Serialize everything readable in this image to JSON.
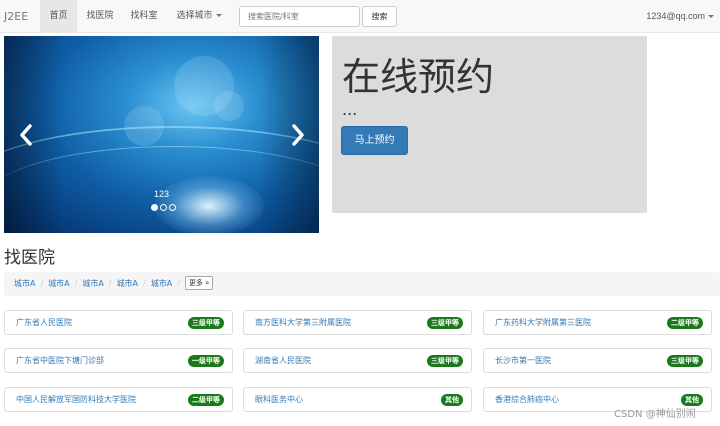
{
  "navbar": {
    "brand": "J2EE",
    "items": [
      {
        "label": "首页",
        "active": true
      },
      {
        "label": "找医院",
        "active": false
      },
      {
        "label": "找科室",
        "active": false
      },
      {
        "label": "选择城市",
        "active": false
      }
    ],
    "search": {
      "placeholder": "搜索医院/科室",
      "button": "搜索"
    },
    "user": "1234@qq.com"
  },
  "carousel": {
    "caption": "123",
    "prev_icon": "chevron-left-icon",
    "next_icon": "chevron-right-icon",
    "slide_count": 3,
    "active_slide": 1
  },
  "jumbotron": {
    "title": "在线预约",
    "text": "...",
    "button": "马上预约"
  },
  "hospitals_section": {
    "title": "找医院",
    "breadcrumb": [
      "城市A",
      "城市A",
      "城市A",
      "城市A",
      "城市A"
    ],
    "more": "更多 »",
    "hospitals": [
      {
        "name": "广东省人民医院",
        "level": "三级甲等"
      },
      {
        "name": "南方医科大学第三附属医院",
        "level": "三级甲等"
      },
      {
        "name": "广东药科大学附属第三医院",
        "level": "二级甲等"
      },
      {
        "name": "广东省中医院下塘门诊部",
        "level": "一级甲等"
      },
      {
        "name": "湖南省人民医院",
        "level": "三级甲等"
      },
      {
        "name": "长沙市第一医院",
        "level": "三级甲等"
      },
      {
        "name": "中国人民解放军国防科技大学医院",
        "level": "二级甲等"
      },
      {
        "name": "眼科医务中心",
        "level": "其他"
      },
      {
        "name": "香港综合肺癌中心",
        "level": "其他"
      }
    ]
  },
  "watermark": "CSDN @神仙别闹",
  "colors": {
    "link": "#337ab7",
    "badge": "#1a7a1a",
    "primary_button": "#337ab7",
    "jumbotron_bg": "#dcdcdc"
  }
}
